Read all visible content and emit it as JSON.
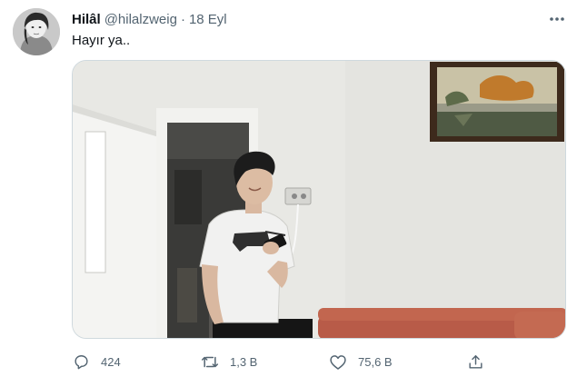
{
  "tweet": {
    "author": {
      "display_name": "Hilâl",
      "handle": "@hilalzweig",
      "separator": "·",
      "date": "18 Eyl"
    },
    "text": "Hayır ya..",
    "actions": {
      "reply_count": "424",
      "retweet_count": "1,3 B",
      "like_count": "75,6 B"
    }
  },
  "icons": {
    "more": "more-horizontal-icon",
    "reply": "reply-icon",
    "retweet": "retweet-icon",
    "like": "heart-icon",
    "share": "share-icon"
  },
  "colors": {
    "text_primary": "#0f1419",
    "text_secondary": "#536471",
    "border": "#cfd9de"
  }
}
